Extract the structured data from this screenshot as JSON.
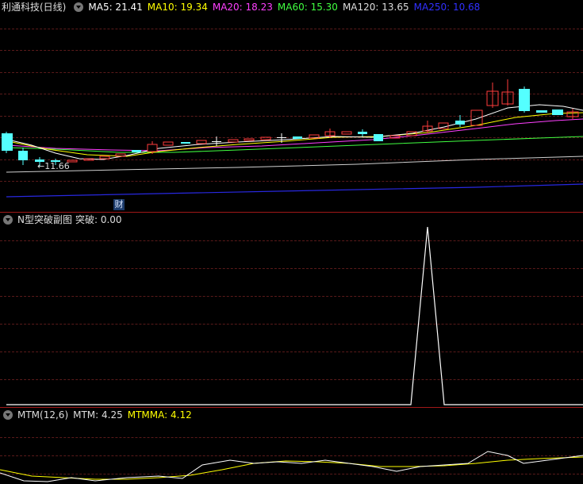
{
  "main_panel": {
    "title": "利通科技(日线)",
    "ma": [
      {
        "label": "MA5: 21.41",
        "color": "#ffffff"
      },
      {
        "label": "MA10: 19.34",
        "color": "#ffff00"
      },
      {
        "label": "MA20: 18.23",
        "color": "#ff40ff"
      },
      {
        "label": "MA60: 15.30",
        "color": "#40ff40"
      },
      {
        "label": "MA120: 13.65",
        "color": "#dddddd"
      },
      {
        "label": "MA250: 10.68",
        "color": "#3030ff"
      }
    ],
    "low_marker": "←11.66",
    "finance_badge": "财"
  },
  "indicator_panel": {
    "title": "N型突破副图",
    "value_text": "突破: 0.00"
  },
  "mtm_panel": {
    "title": "MTM(12,6)",
    "mtm": "MTM: 4.25",
    "mtmma": "MTMMA: 4.12"
  },
  "colors": {
    "up_candle": "#ff3c3c",
    "down_candle": "#54ffff",
    "grid": "#5a1a1a",
    "separator": "#a01818"
  },
  "icons": [
    "collapse-circle-icon"
  ]
}
